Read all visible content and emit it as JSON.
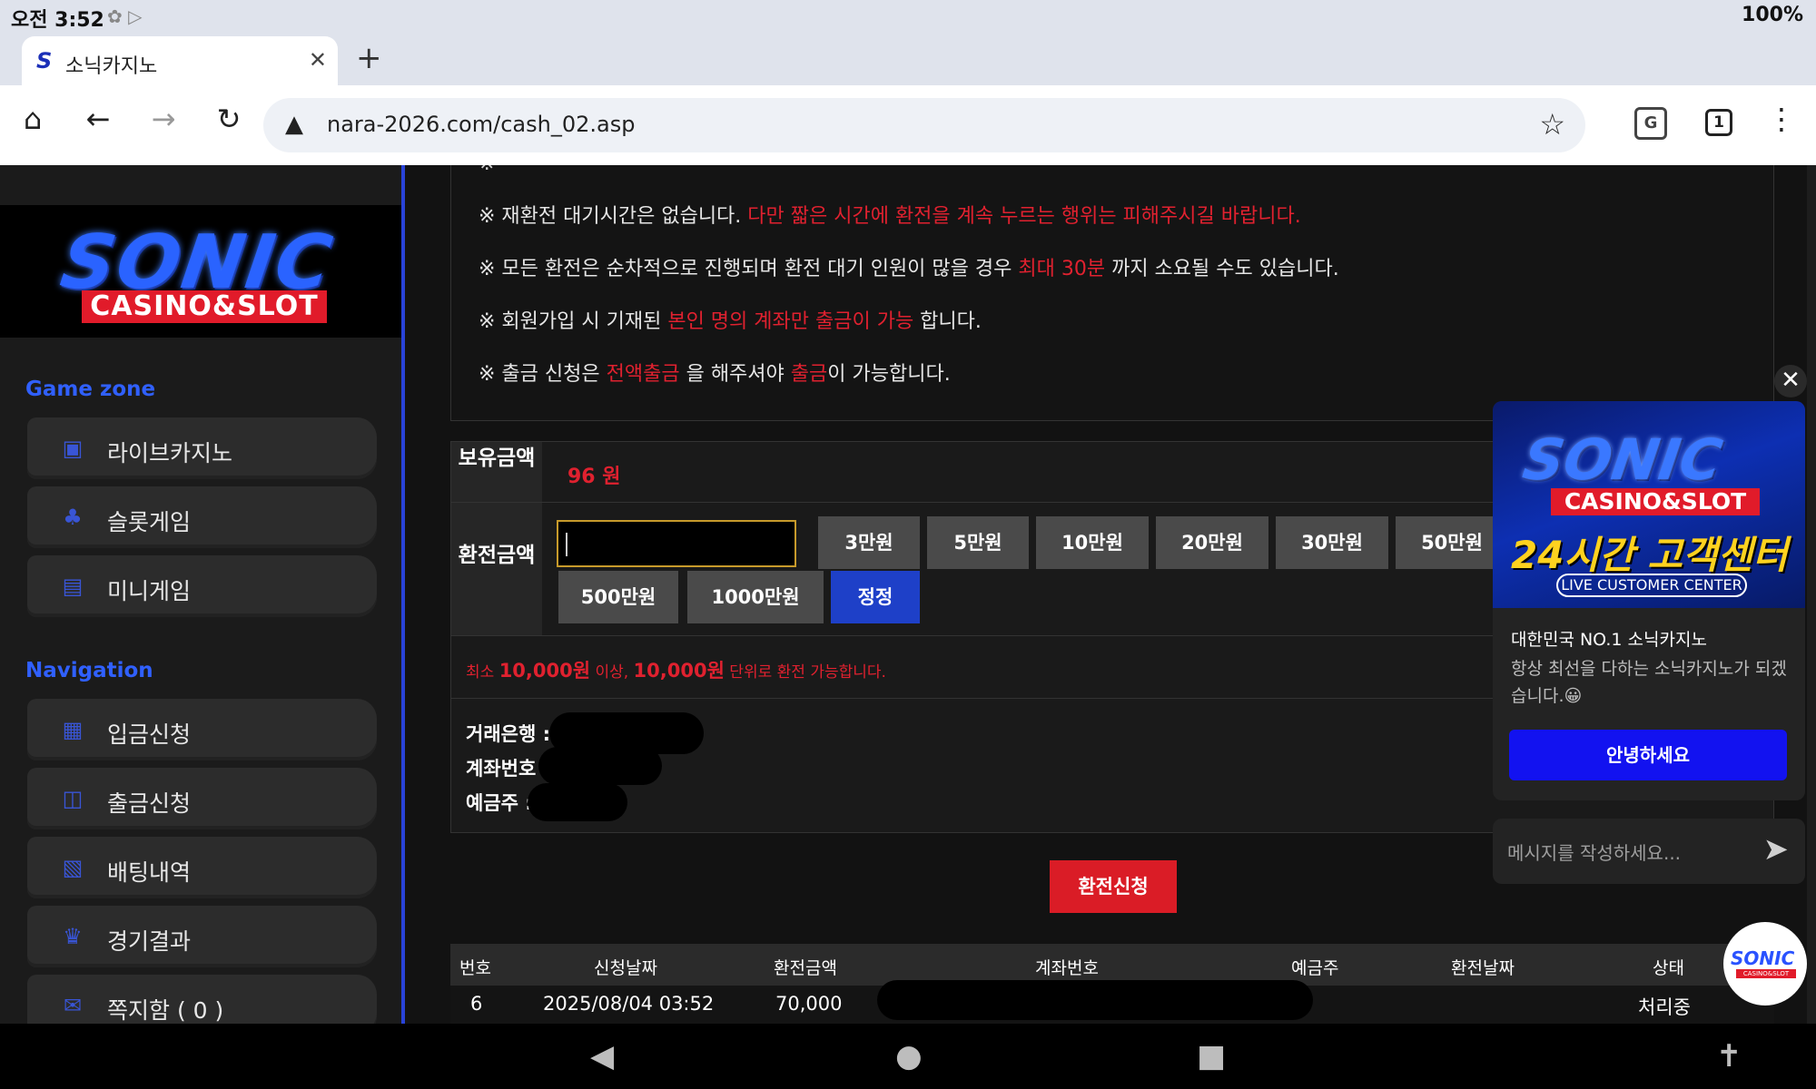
{
  "status": {
    "time": "오전 3:52",
    "battery": "100%"
  },
  "browser": {
    "tab_title": "소닉카지노",
    "url": "nara-2026.com/cash_02.asp",
    "tab_count": "1"
  },
  "logo": {
    "main": "SONIC",
    "sub": "CASINO&SLOT"
  },
  "sidebar": {
    "game_zone_title": "Game zone",
    "game_items": [
      {
        "label": "라이브카지노",
        "icon": "live-casino-icon"
      },
      {
        "label": "슬롯게임",
        "icon": "slot-icon"
      },
      {
        "label": "미니게임",
        "icon": "mini-game-icon"
      }
    ],
    "navigation_title": "Navigation",
    "nav_items": [
      {
        "label": "입금신청",
        "icon": "deposit-icon"
      },
      {
        "label": "출금신청",
        "icon": "wallet-icon"
      },
      {
        "label": "배팅내역",
        "icon": "betting-history-icon"
      },
      {
        "label": "경기결과",
        "icon": "trophy-icon"
      },
      {
        "label": "쪽지함 ( 0 )",
        "icon": "message-icon"
      }
    ]
  },
  "notice": {
    "line1_a": "※ 재환전 대기시간은 없습니다. ",
    "line1_red": "다만 짧은 시간에 환전을 계속 누르는 행위는 피해주시길 바랍니다.",
    "line2_a": "※ 모든 환전은 순차적으로 진행되며 환전 대기 인원이 많을 경우 ",
    "line2_red": "최대 30분",
    "line2_b": " 까지 소요될 수도 있습니다.",
    "line3_a": "※ 회원가입 시 기재된 ",
    "line3_red": "본인 명의 계좌만 출금이 가능",
    "line3_b": " 합니다.",
    "line4_a": "※ 출금 신청은 ",
    "line4_red1": "전액출금",
    "line4_b": " 을 해주셔야 ",
    "line4_red2": "출금",
    "line4_c": "이 가능합니다."
  },
  "form": {
    "balance_label": "보유금액",
    "balance_value": "96 원",
    "amount_label": "환전금액",
    "amount_value": "",
    "buttons_row1": [
      "3만원",
      "5만원",
      "10만원",
      "20만원",
      "30만원",
      "50만원"
    ],
    "buttons_row2": [
      "500만원",
      "1000만원"
    ],
    "reset_label": "정정",
    "min_note_a": "최소 ",
    "min_note_b": "10,000원",
    "min_note_c": " 이상, ",
    "min_note_d": "10,000원",
    "min_note_e": " 단위로 환전 가능합니다.",
    "bank_label": "거래은행 :",
    "account_label": "계좌번호 :",
    "holder_label": "예금주 :",
    "submit_label": "환전신청"
  },
  "history": {
    "columns": [
      "번호",
      "신청날짜",
      "환전금액",
      "계좌번호",
      "예금주",
      "환전날짜",
      "상태"
    ],
    "rows": [
      {
        "no": "6",
        "date": "2025/08/04 03:52",
        "amount": "70,000",
        "account": "",
        "holder": "",
        "done_date": "",
        "status": "처리중"
      }
    ]
  },
  "chat": {
    "banner_main": "SONIC",
    "banner_sub": "CASINO&SLOT",
    "banner_24": "24시간 고객센터",
    "banner_live": "LIVE CUSTOMER CENTER",
    "title": "대한민국 NO.1 소닉카지노",
    "subtitle": "항상 최선을 다하는 소닉카지노가 되겠습니다.😀",
    "hello_button": "안녕하세요",
    "input_placeholder": "메시지를 작성하세요...",
    "fab_logo": "SONIC",
    "fab_sub": "CASINO&SLOT"
  },
  "colors": {
    "accent_red": "#e0212f",
    "accent_blue": "#2943d8",
    "chat_blue": "#1212f0"
  }
}
